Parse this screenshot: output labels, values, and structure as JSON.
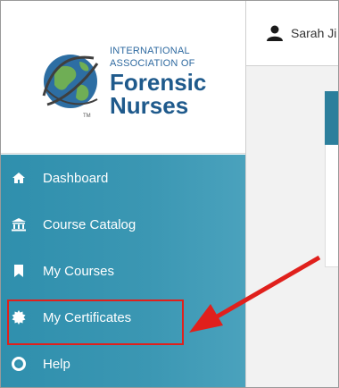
{
  "org": {
    "line1": "INTERNATIONAL",
    "line2": "ASSOCIATION OF",
    "line3": "Forensic",
    "line4": "Nurses",
    "tm": "TM",
    "logo_icon": "globe-helix-icon"
  },
  "sidebar": {
    "items": [
      {
        "label": "Dashboard",
        "icon": "home-icon"
      },
      {
        "label": "Course Catalog",
        "icon": "bank-icon"
      },
      {
        "label": "My Courses",
        "icon": "bookmark-icon"
      },
      {
        "label": "My Certificates",
        "icon": "certificate-icon",
        "highlighted": true
      },
      {
        "label": "Help",
        "icon": "life-ring-icon"
      }
    ]
  },
  "header": {
    "user_name": "Sarah Ji",
    "user_icon": "user-icon"
  },
  "colors": {
    "nav_background": "#3b97b3",
    "annotation": "#e0201c",
    "brand_blue": "#1f5a8c",
    "card_header": "#2c7f9c"
  }
}
